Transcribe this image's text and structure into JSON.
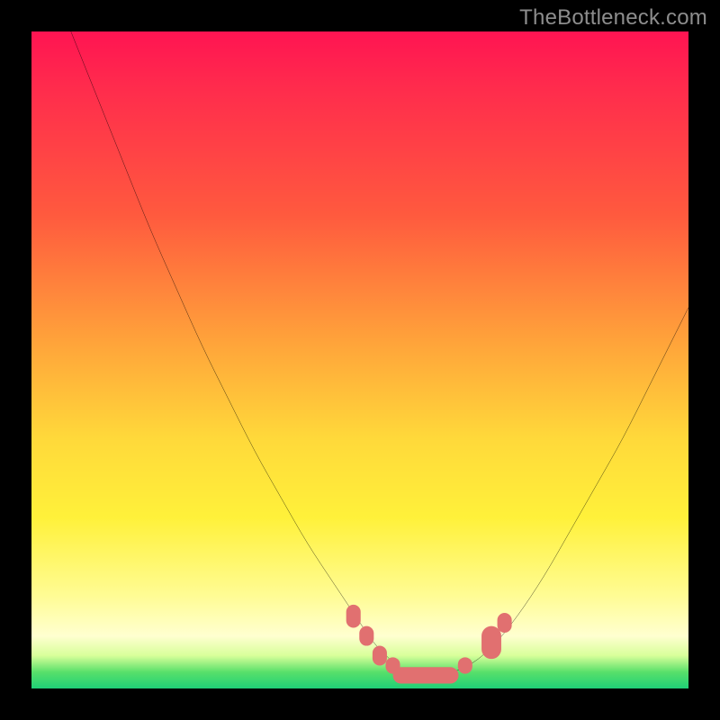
{
  "watermark": "TheBottleneck.com",
  "chart_data": {
    "type": "line",
    "title": "",
    "xlabel": "",
    "ylabel": "",
    "xlim": [
      0,
      100
    ],
    "ylim": [
      0,
      100
    ],
    "grid": false,
    "legend": false,
    "background_gradient_stops": [
      {
        "pos": 0,
        "color": "#ff1452"
      },
      {
        "pos": 8,
        "color": "#ff2a4d"
      },
      {
        "pos": 28,
        "color": "#ff5a3e"
      },
      {
        "pos": 48,
        "color": "#ffa63a"
      },
      {
        "pos": 62,
        "color": "#ffd93a"
      },
      {
        "pos": 74,
        "color": "#fff13a"
      },
      {
        "pos": 86,
        "color": "#fffc95"
      },
      {
        "pos": 92,
        "color": "#ffffd0"
      },
      {
        "pos": 95,
        "color": "#d8ff9a"
      },
      {
        "pos": 97.5,
        "color": "#58e06a"
      },
      {
        "pos": 100,
        "color": "#1fcf77"
      }
    ],
    "series": [
      {
        "name": "curve",
        "color": "#000000",
        "x": [
          6,
          10,
          14,
          18,
          22,
          26,
          30,
          34,
          38,
          42,
          46,
          50,
          52,
          54,
          56,
          58,
          60,
          62,
          66,
          70,
          74,
          78,
          82,
          86,
          90,
          94,
          98,
          100
        ],
        "y": [
          100,
          90,
          80,
          70,
          61,
          52,
          44,
          36,
          29,
          22,
          16,
          10,
          7,
          5,
          3,
          2,
          2,
          2,
          3,
          6,
          11,
          17,
          24,
          31,
          38,
          46,
          54,
          58
        ]
      }
    ],
    "markers": {
      "name": "trough-markers",
      "color": "#e17070",
      "shape": "rounded",
      "points": [
        {
          "x": 49,
          "y": 11,
          "w": 2.2,
          "h": 3.5
        },
        {
          "x": 51,
          "y": 8,
          "w": 2.2,
          "h": 3.0
        },
        {
          "x": 53,
          "y": 5,
          "w": 2.2,
          "h": 3.0
        },
        {
          "x": 55,
          "y": 3.5,
          "w": 2.2,
          "h": 2.5
        },
        {
          "x": 60,
          "y": 2,
          "w": 10,
          "h": 2.5
        },
        {
          "x": 66,
          "y": 3.5,
          "w": 2.2,
          "h": 2.5
        },
        {
          "x": 70,
          "y": 7,
          "w": 3.0,
          "h": 5.0
        },
        {
          "x": 72,
          "y": 10,
          "w": 2.2,
          "h": 3.0
        }
      ]
    }
  }
}
